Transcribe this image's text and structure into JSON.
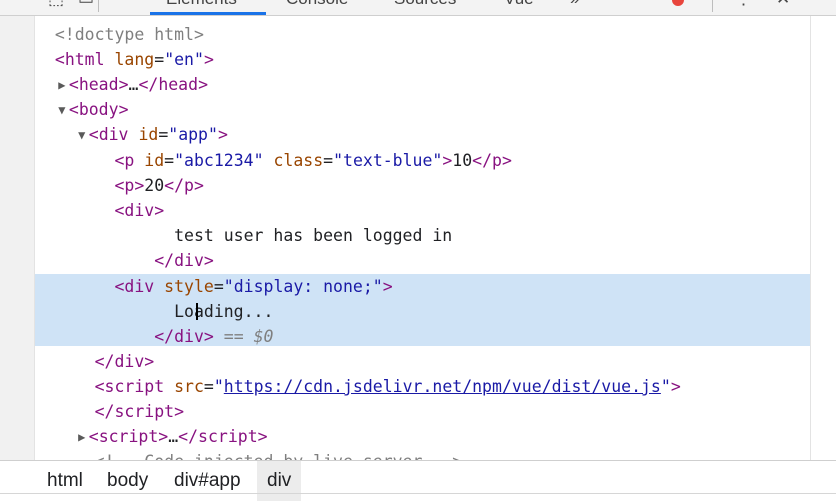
{
  "tabs": [
    {
      "label": "Elements",
      "active": true
    },
    {
      "label": "Console",
      "active": false
    },
    {
      "label": "Sources",
      "active": false
    },
    {
      "label": "Vue",
      "active": false
    },
    {
      "label": "»",
      "active": false
    }
  ],
  "dom_tree": {
    "doctype": "<!doctype html>",
    "html_tag": "html",
    "lang_attr": "lang",
    "lang_value": "en",
    "head_tag": "head",
    "body_tag": "body",
    "div_tag": "div",
    "id_attr": "id",
    "app_value": "app",
    "p_tag": "p",
    "abc_value": "abc1234",
    "class_attr": "class",
    "class_value": "text-blue",
    "p1_text": "10",
    "p2_text": "20",
    "div_text": "test user has been logged in",
    "style_attr": "style",
    "style_value": "display: none;",
    "loading_text": "Loading...",
    "dollar_ref": "== $0",
    "script_tag": "script",
    "src_attr": "src",
    "src_value": "https://cdn.jsdelivr.net/npm/vue/dist/vue.js",
    "ellipsis": "…",
    "comment_partial": "<!-- Code injected by live-server -->"
  },
  "breadcrumbs": [
    {
      "label": "html",
      "active": false
    },
    {
      "label": "body",
      "active": false
    },
    {
      "label": "div#app",
      "active": false
    },
    {
      "label": "div",
      "active": true
    }
  ],
  "colors": {
    "tag": "#881280",
    "attr_name": "#994500",
    "attr_value": "#1a1aa6",
    "selection": "#cfe3f6",
    "active_tab_underline": "#1a73e8"
  },
  "icons": [
    "inspect-icon",
    "device-toolbar-icon",
    "error-badge-icon",
    "more-icon",
    "settings-icon",
    "expand-triangle-icon",
    "collapse-triangle-icon"
  ]
}
